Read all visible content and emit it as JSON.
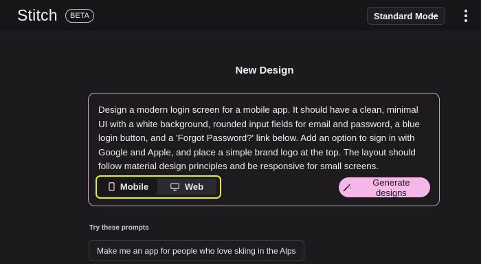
{
  "app": {
    "name": "Stitch",
    "badge": "BETA"
  },
  "header": {
    "mode_label": "Standard Mode",
    "mode_icon": "chevron-down-icon",
    "menu_icon": "more-vert-icon"
  },
  "main": {
    "title": "New Design",
    "prompt_text": "Design a modern login screen for a mobile app. It should have a clean, minimal UI with a white background, rounded input fields for email and password, a blue login button, and a 'Forgot Password?' link below. Add an option to sign in with Google and Apple, and place a simple brand logo at the top. The layout should follow material design principles and be responsive for small screens.",
    "platform_options": [
      {
        "label": "Mobile",
        "icon": "phone-icon",
        "selected": true
      },
      {
        "label": "Web",
        "icon": "monitor-icon",
        "selected": false
      }
    ],
    "generate_label": "Generate designs",
    "generate_icon": "magic-wand-icon"
  },
  "suggestions": {
    "heading": "Try these prompts",
    "items": [
      "Make me an app for people who love skiing in the Alps"
    ]
  },
  "colors": {
    "background": "#1b1a1d",
    "card_border": "#c8a3bd",
    "generate_button": "#f4b7e7",
    "highlight": "#e3f22c"
  }
}
